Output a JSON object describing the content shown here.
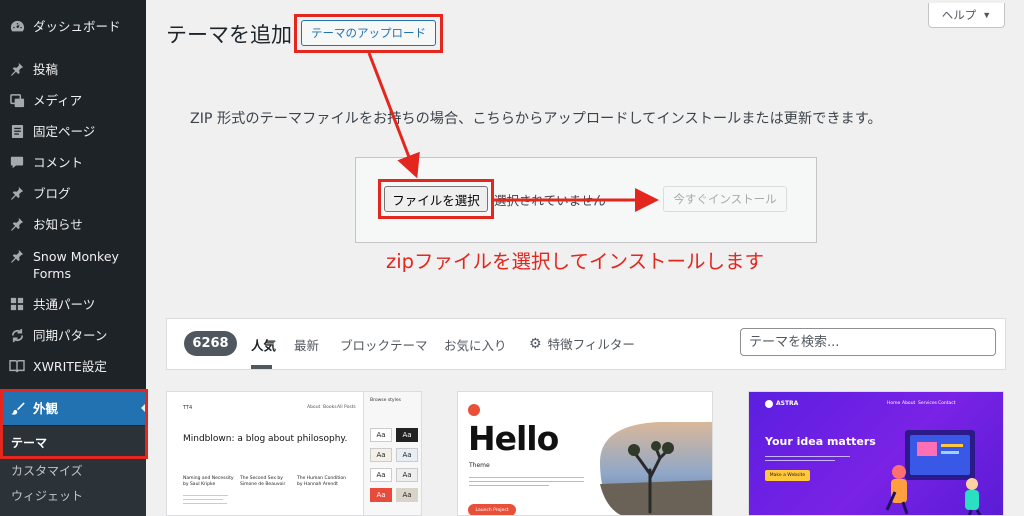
{
  "sidebar": {
    "items": [
      {
        "label": "ダッシュボード",
        "icon": "dashboard-icon"
      },
      {
        "label": "投稿",
        "icon": "pin-icon"
      },
      {
        "label": "メディア",
        "icon": "media-icon"
      },
      {
        "label": "固定ページ",
        "icon": "page-icon"
      },
      {
        "label": "コメント",
        "icon": "comment-icon"
      },
      {
        "label": "ブログ",
        "icon": "pin-icon"
      },
      {
        "label": "お知らせ",
        "icon": "pin-icon"
      },
      {
        "label": "Snow Monkey Forms",
        "icon": "pin-icon"
      },
      {
        "label": "共通パーツ",
        "icon": "grid-icon"
      },
      {
        "label": "同期パターン",
        "icon": "sync-icon"
      },
      {
        "label": "XWRITE設定",
        "icon": "book-icon"
      },
      {
        "label": "外観",
        "icon": "brush-icon"
      }
    ],
    "submenu": [
      "テーマ",
      "カスタマイズ",
      "ウィジェット"
    ]
  },
  "header": {
    "title": "テーマを追加",
    "upload_label": "テーマのアップロード",
    "help_label": "ヘルプ"
  },
  "upload": {
    "description": "ZIP 形式のテーマファイルをお持ちの場合、こちらからアップロードしてインストールまたは更新できます。",
    "file_button": "ファイルを選択",
    "file_status": "選択されていません",
    "install_button": "今すぐインストール",
    "annotation": "zipファイルを選択してインストールします"
  },
  "filter": {
    "count": "6268",
    "tabs": [
      "人気",
      "最新",
      "ブロックテーマ",
      "お気に入り"
    ],
    "feature_filter": "特徴フィルター",
    "search_placeholder": "テーマを検索..."
  },
  "themes": {
    "tt": {
      "brand": "TT4",
      "nav": [
        "About",
        "Books",
        "All Posts"
      ],
      "headline": "Mindblown: a blog about philosophy.",
      "posts": [
        {
          "title": "Naming and Necessity",
          "author": "by Saul Kripke"
        },
        {
          "title": "The Second Sex by",
          "author": "Simone de Beauvoir"
        },
        {
          "title": "The Human Condition",
          "author": "by Hannah Arendt"
        }
      ],
      "styles_title": "Browse styles",
      "style_sample": "Aa"
    },
    "hello": {
      "headline": "Hello",
      "sub": "Theme",
      "cta": "Launch Project"
    },
    "astra": {
      "brand": "ASTRA",
      "nav": [
        "Home",
        "About",
        "Services",
        "Contact"
      ],
      "headline": "Your idea matters",
      "cta": "Make a Website"
    }
  },
  "colors": {
    "admin_bar": "#1d2327",
    "accent": "#2271b1",
    "annotation_red": "#e3261e",
    "hello_red": "#e8503a"
  }
}
